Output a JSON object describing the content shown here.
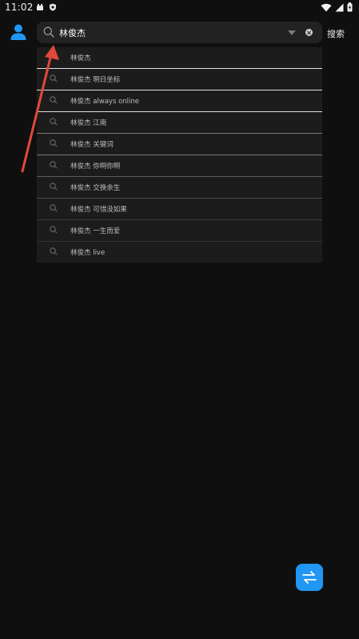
{
  "status_bar": {
    "time": "11:02"
  },
  "search": {
    "value": "林俊杰",
    "button_label": "搜索"
  },
  "suggestions": [
    "林俊杰",
    "林俊杰 明日坐标",
    "林俊杰 always online",
    "林俊杰 江南",
    "林俊杰 关键词",
    "林俊杰 你啊你啊",
    "林俊杰 交换余生",
    "林俊杰 可惜没如果",
    "林俊杰 一生而爱",
    "林俊杰 live"
  ],
  "icons": {
    "avatar": "user-icon",
    "search": "search-icon",
    "dropdown": "chevron-down-icon",
    "clear": "clear-icon",
    "switch": "swap-icon"
  },
  "colors": {
    "background": "#0f0f0f",
    "accent": "#2196f3",
    "arrow": "#e04a3a"
  }
}
